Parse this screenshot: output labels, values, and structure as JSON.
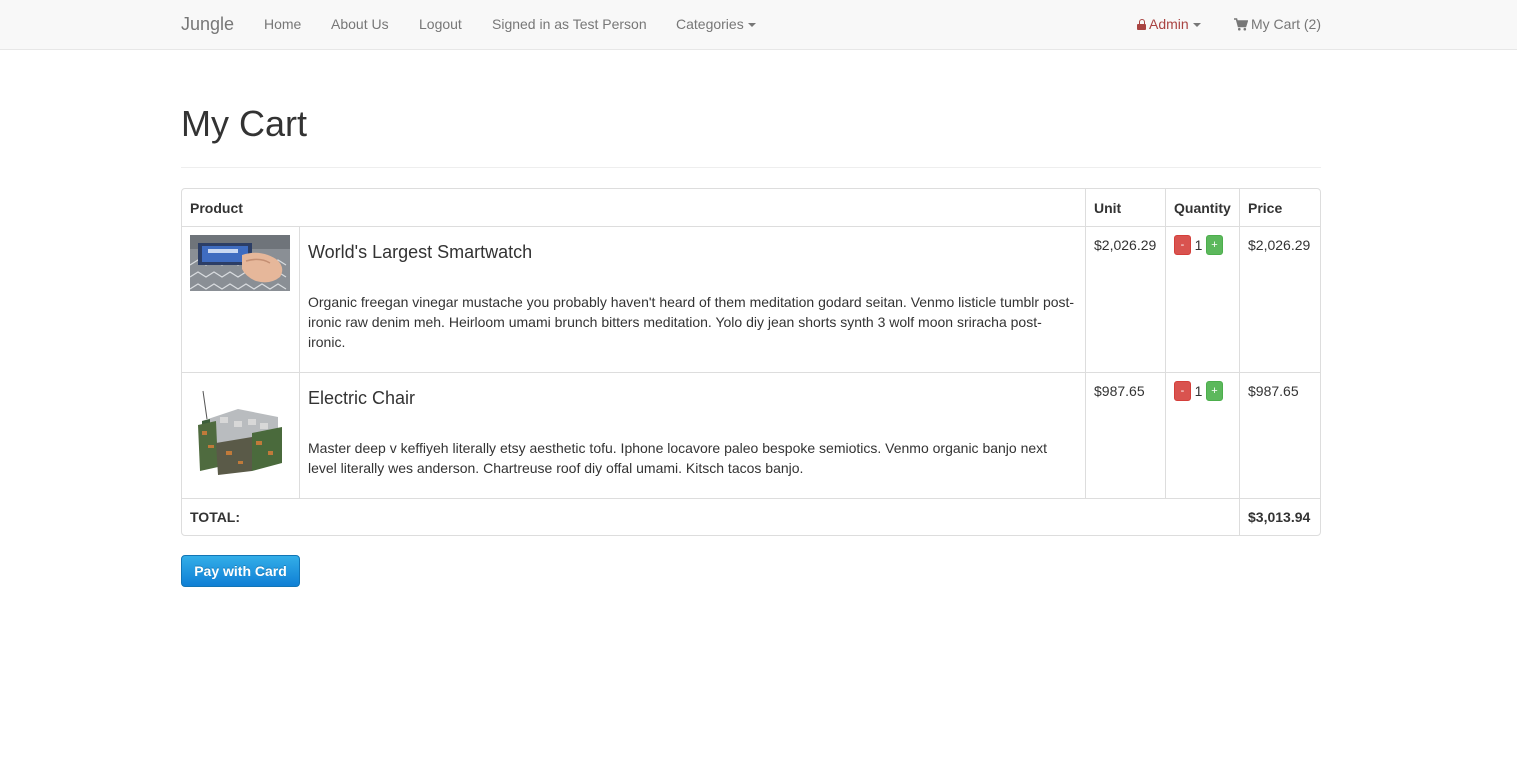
{
  "navbar": {
    "brand": "Jungle",
    "links": {
      "home": "Home",
      "about": "About Us",
      "logout": "Logout",
      "signed_in": "Signed in as Test Person",
      "categories": "Categories"
    },
    "admin": "Admin",
    "cart": "My Cart (2)"
  },
  "page": {
    "title": "My Cart"
  },
  "table": {
    "headers": {
      "product": "Product",
      "unit": "Unit",
      "quantity": "Quantity",
      "price": "Price"
    },
    "items": [
      {
        "name": "World's Largest Smartwatch",
        "description": "Organic freegan vinegar mustache you probably haven't heard of them meditation godard seitan. Venmo listicle tumblr post-ironic raw denim meh. Heirloom umami brunch bitters meditation. Yolo diy jean shorts synth 3 wolf moon sriracha post-ironic.",
        "unit": "$2,026.29",
        "quantity": "1",
        "price": "$2,026.29",
        "image_icon": "smartwatch-photo"
      },
      {
        "name": "Electric Chair",
        "description": "Master deep v keffiyeh literally etsy aesthetic tofu. Iphone locavore paleo bespoke semiotics. Venmo organic banjo next level literally wes anderson. Chartreuse roof diy offal umami. Kitsch tacos banjo.",
        "unit": "$987.65",
        "quantity": "1",
        "price": "$987.65",
        "image_icon": "electric-chair-photo"
      }
    ],
    "minus_label": "-",
    "plus_label": "+",
    "total_label": "TOTAL:",
    "total_value": "$3,013.94"
  },
  "pay_button": "Pay with Card",
  "colors": {
    "danger": "#d9534f",
    "success": "#5cb85c",
    "admin": "#a94442",
    "pay": "#1a8ad8"
  }
}
